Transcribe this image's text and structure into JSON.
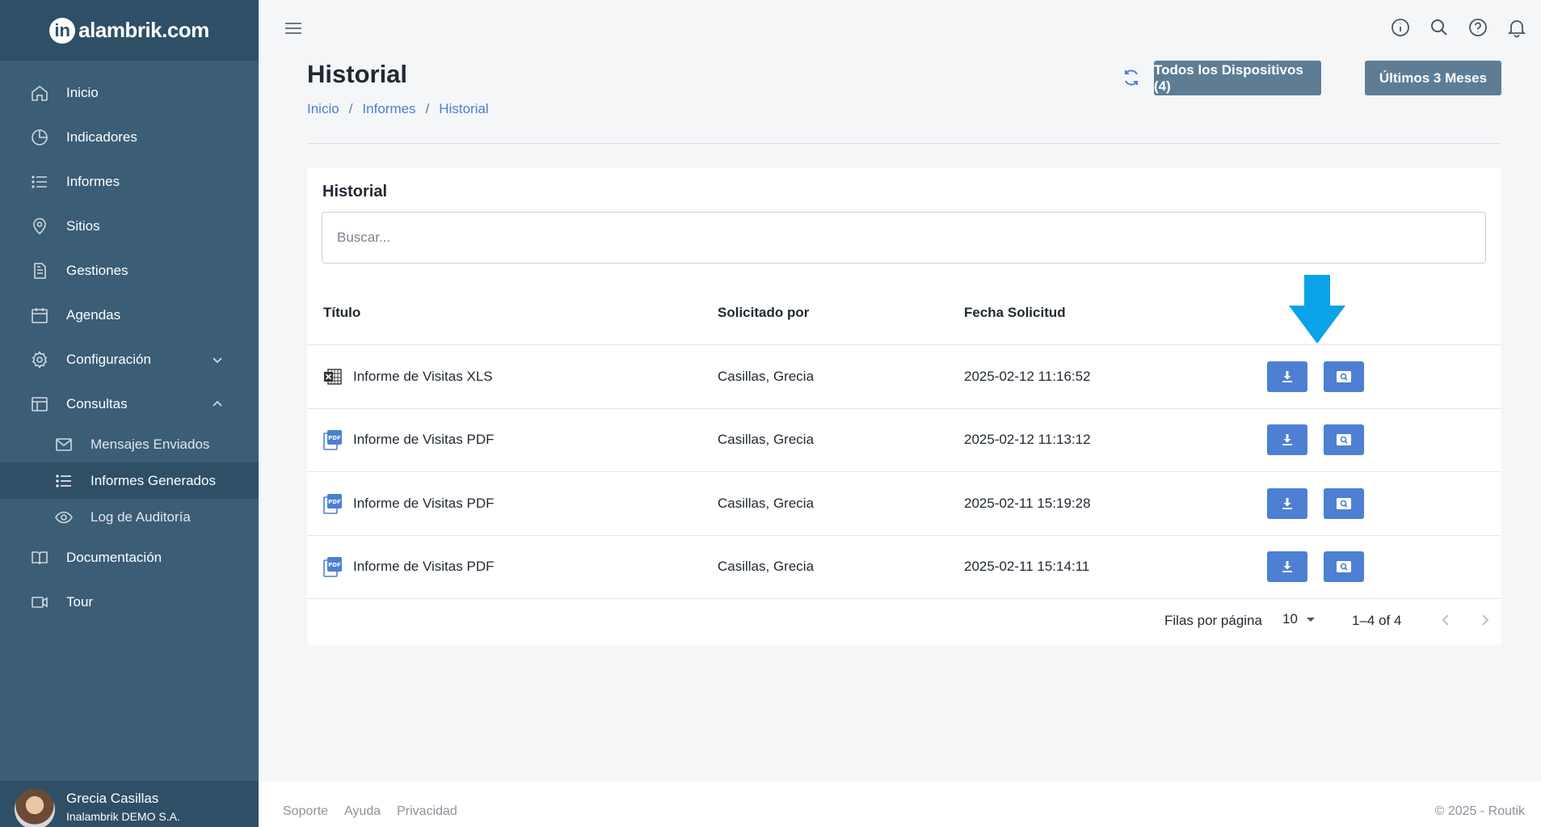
{
  "brand": {
    "mark": "in",
    "name": "alambrik.com"
  },
  "sidebar": {
    "items": [
      {
        "label": "Inicio",
        "icon": "home-icon"
      },
      {
        "label": "Indicadores",
        "icon": "pie-chart-icon"
      },
      {
        "label": "Informes",
        "icon": "list-icon"
      },
      {
        "label": "Sitios",
        "icon": "map-pin-icon"
      },
      {
        "label": "Gestiones",
        "icon": "document-icon"
      },
      {
        "label": "Agendas",
        "icon": "calendar-icon"
      },
      {
        "label": "Configuración",
        "icon": "gear-icon"
      },
      {
        "label": "Consultas",
        "icon": "table-icon"
      },
      {
        "label": "Documentación",
        "icon": "book-icon"
      },
      {
        "label": "Tour",
        "icon": "video-icon"
      }
    ],
    "consultas_sub": [
      {
        "label": "Mensajes Enviados",
        "icon": "mail-icon"
      },
      {
        "label": "Informes Generados",
        "icon": "list-icon"
      },
      {
        "label": "Log de Auditoría",
        "icon": "eye-icon"
      }
    ],
    "user": {
      "name": "Grecia Casillas",
      "company": "Inalambrik DEMO S.A."
    }
  },
  "header": {
    "title": "Historial",
    "breadcrumb": [
      "Inicio",
      "Informes",
      "Historial"
    ],
    "devices_button": "Todos los Dispositivos (4)",
    "period_button": "Últimos 3 Meses"
  },
  "card": {
    "title": "Historial",
    "search_placeholder": "Buscar...",
    "columns": [
      "Título",
      "Solicitado por",
      "Fecha Solicitud"
    ],
    "rows": [
      {
        "title": "Informe de Visitas XLS",
        "type": "xls",
        "requested_by": "Casillas, Grecia",
        "date": "2025-02-12 11:16:52"
      },
      {
        "title": "Informe de Visitas PDF",
        "type": "pdf",
        "requested_by": "Casillas, Grecia",
        "date": "2025-02-12 11:13:12"
      },
      {
        "title": "Informe de Visitas PDF",
        "type": "pdf",
        "requested_by": "Casillas, Grecia",
        "date": "2025-02-11 15:19:28"
      },
      {
        "title": "Informe de Visitas PDF",
        "type": "pdf",
        "requested_by": "Casillas, Grecia",
        "date": "2025-02-11 15:14:11"
      }
    ],
    "pagination": {
      "rows_per_page_label": "Filas por página",
      "rows_per_page": "10",
      "range": "1–4 of 4"
    }
  },
  "footer": {
    "links": [
      "Soporte",
      "Ayuda",
      "Privacidad"
    ],
    "copyright": "© 2025 - Routik"
  },
  "colors": {
    "sidebar": "#3b5d76",
    "sidebar_dark": "#2f4f67",
    "primary_button": "#4d7fd4",
    "header_button": "#5e7d95",
    "link": "#4a7fd0",
    "annotation_arrow": "#0aa3e8"
  }
}
